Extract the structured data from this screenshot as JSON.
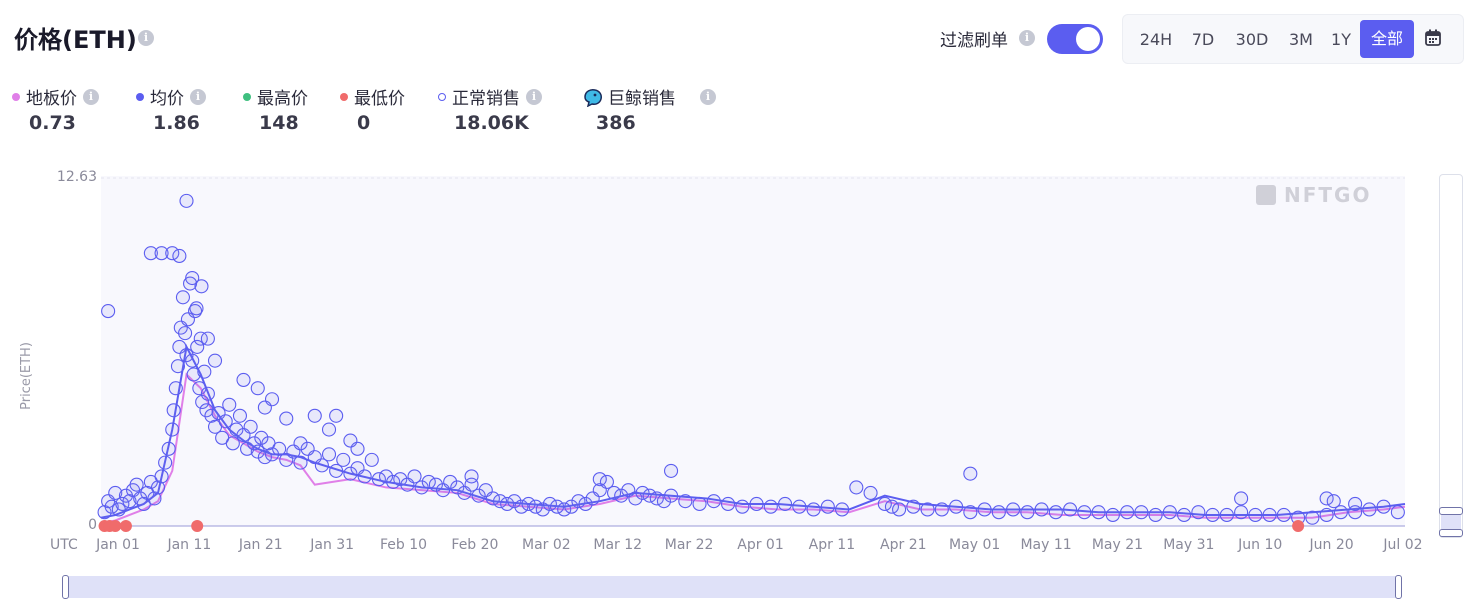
{
  "header": {
    "title": "价格(ETH)",
    "filter_label": "过滤刷单",
    "filter_on": true,
    "ranges": [
      "24H",
      "7D",
      "30D",
      "3M",
      "1Y",
      "全部"
    ],
    "active_range": "全部"
  },
  "legend": [
    {
      "label": "地板价",
      "value": "0.73",
      "color": "#e07fe8",
      "marker": "dot"
    },
    {
      "label": "均价",
      "value": "1.86",
      "color": "#5b5df0",
      "marker": "dot"
    },
    {
      "label": "最高价",
      "value": "148",
      "color": "#3fbf7f",
      "marker": "dot"
    },
    {
      "label": "最低价",
      "value": "0",
      "color": "#f06b6b",
      "marker": "dot"
    },
    {
      "label": "正常销售",
      "value": "18.06K",
      "color": "#5b5df0",
      "marker": "ring"
    },
    {
      "label": "巨鲸销售",
      "value": "386",
      "color": "#2a9fd6",
      "marker": "whale"
    }
  ],
  "chart_data": {
    "type": "scatter",
    "ylabel": "Price(ETH)",
    "ylim": [
      0,
      12.63
    ],
    "yticks": [
      "0",
      "12.63"
    ],
    "xlabel_prefix": "UTC",
    "xticks": [
      "Jan 01",
      "Jan 11",
      "Jan 21",
      "Jan 31",
      "Feb 10",
      "Feb 20",
      "Mar 02",
      "Mar 12",
      "Mar 22",
      "Apr 01",
      "Apr 11",
      "Apr 21",
      "May 01",
      "May 11",
      "May 21",
      "May 31",
      "Jun 10",
      "Jun 20",
      "Jul 02"
    ],
    "xlim_days": [
      0,
      183
    ],
    "watermark": "NFTGO",
    "series": [
      {
        "name": "地板价",
        "color": "#e07fe8",
        "x": [
          0,
          2,
          4,
          6,
          8,
          10,
          12,
          14,
          16,
          18,
          20,
          22,
          24,
          26,
          28,
          30,
          35,
          40,
          45,
          50,
          55,
          60,
          65,
          70,
          75,
          80,
          85,
          90,
          95,
          100,
          105,
          110,
          115,
          120,
          125,
          130,
          135,
          140,
          145,
          150,
          155,
          160,
          165,
          170,
          175,
          180,
          183
        ],
        "y": [
          0.1,
          0.2,
          0.4,
          0.6,
          0.9,
          2.0,
          5.5,
          5.0,
          4.0,
          3.3,
          3.0,
          2.7,
          2.5,
          2.4,
          2.2,
          1.5,
          1.7,
          1.4,
          1.3,
          1.2,
          0.8,
          0.7,
          0.6,
          0.8,
          1.1,
          1.0,
          0.9,
          0.7,
          0.6,
          0.6,
          0.5,
          0.9,
          0.6,
          0.6,
          0.5,
          0.5,
          0.4,
          0.4,
          0.4,
          0.4,
          0.3,
          0.3,
          0.3,
          0.3,
          0.5,
          0.6,
          0.7
        ]
      },
      {
        "name": "均价",
        "color": "#5b5df0",
        "x": [
          0,
          2,
          4,
          6,
          8,
          10,
          12,
          14,
          16,
          18,
          20,
          22,
          24,
          26,
          28,
          30,
          35,
          40,
          45,
          50,
          55,
          60,
          65,
          70,
          75,
          80,
          85,
          90,
          95,
          100,
          105,
          110,
          115,
          120,
          125,
          130,
          135,
          140,
          145,
          150,
          155,
          160,
          165,
          170,
          175,
          180,
          183
        ],
        "y": [
          0.3,
          0.4,
          0.6,
          0.8,
          1.2,
          3.5,
          6.5,
          5.5,
          4.2,
          3.5,
          3.1,
          2.8,
          2.6,
          2.6,
          2.5,
          2.3,
          1.9,
          1.6,
          1.4,
          1.3,
          0.9,
          0.8,
          0.7,
          0.9,
          1.2,
          1.1,
          1.0,
          0.8,
          0.8,
          0.7,
          0.6,
          1.1,
          0.8,
          0.7,
          0.6,
          0.6,
          0.6,
          0.5,
          0.5,
          0.5,
          0.4,
          0.4,
          0.4,
          0.5,
          0.6,
          0.7,
          0.8
        ]
      },
      {
        "name": "正常销售",
        "color": "#5b5df0",
        "x": [
          0.5,
          1,
          1.5,
          2,
          2.5,
          3,
          3.5,
          4,
          4.5,
          5,
          5.5,
          6,
          6.5,
          7,
          7.5,
          8,
          8.5,
          9,
          9.5,
          10,
          10.2,
          10.5,
          10.8,
          11,
          11.2,
          11.5,
          11.8,
          12,
          12.2,
          12.5,
          12.8,
          13,
          13.2,
          13.5,
          13.8,
          14,
          14.2,
          14.5,
          14.8,
          15,
          15.5,
          16,
          16.5,
          17,
          17.5,
          18,
          18.5,
          19,
          19.5,
          20,
          20.5,
          21,
          21.5,
          22,
          22.5,
          23,
          23.5,
          24,
          25,
          26,
          27,
          28,
          29,
          30,
          31,
          32,
          33,
          34,
          35,
          36,
          37,
          38,
          39,
          40,
          41,
          42,
          43,
          44,
          45,
          46,
          47,
          48,
          49,
          50,
          51,
          52,
          53,
          54,
          55,
          56,
          57,
          58,
          59,
          60,
          61,
          62,
          63,
          64,
          65,
          66,
          67,
          68,
          69,
          70,
          71,
          72,
          73,
          74,
          75,
          76,
          77,
          78,
          79,
          80,
          82,
          84,
          86,
          88,
          90,
          92,
          94,
          96,
          98,
          100,
          102,
          104,
          106,
          108,
          110,
          111,
          112,
          114,
          116,
          118,
          120,
          122,
          124,
          126,
          128,
          130,
          132,
          134,
          136,
          138,
          140,
          142,
          144,
          146,
          148,
          150,
          152,
          154,
          156,
          158,
          160,
          162,
          164,
          166,
          168,
          170,
          172,
          174,
          176,
          178,
          180,
          182,
          1,
          7,
          8.5,
          10,
          11,
          12,
          12.8,
          13.4,
          14.1,
          15,
          16,
          20,
          22,
          23,
          24,
          26,
          28,
          30,
          32,
          33,
          35,
          36,
          52,
          70,
          80,
          122,
          160,
          172,
          173,
          176
        ],
        "y": [
          0.5,
          0.9,
          0.7,
          1.2,
          0.6,
          0.8,
          1.1,
          0.9,
          1.3,
          1.5,
          1.0,
          0.8,
          1.2,
          1.6,
          1.0,
          1.4,
          1.8,
          2.3,
          2.8,
          3.5,
          4.2,
          5.0,
          5.8,
          6.5,
          7.2,
          8.3,
          7.0,
          6.2,
          7.5,
          8.8,
          6.0,
          5.5,
          7.8,
          6.5,
          5.0,
          6.8,
          4.5,
          5.6,
          4.2,
          4.8,
          4.0,
          3.6,
          4.1,
          3.2,
          3.8,
          4.4,
          3.0,
          3.5,
          4.0,
          3.3,
          2.8,
          3.6,
          3.0,
          2.7,
          3.2,
          2.5,
          3.0,
          2.6,
          2.8,
          2.4,
          2.7,
          2.3,
          2.8,
          2.5,
          2.2,
          2.6,
          2.0,
          2.4,
          1.9,
          2.1,
          1.8,
          2.4,
          1.7,
          1.8,
          1.6,
          1.7,
          1.5,
          1.8,
          1.4,
          1.6,
          1.5,
          1.3,
          1.6,
          1.4,
          1.2,
          1.5,
          1.1,
          1.3,
          1.0,
          0.9,
          0.8,
          0.9,
          0.7,
          0.8,
          0.7,
          0.6,
          0.8,
          0.7,
          0.6,
          0.7,
          0.9,
          0.8,
          1.0,
          1.3,
          1.6,
          1.2,
          1.1,
          1.3,
          1.0,
          1.2,
          1.1,
          1.0,
          0.9,
          1.1,
          0.9,
          0.8,
          0.9,
          0.8,
          0.7,
          0.8,
          0.7,
          0.8,
          0.7,
          0.6,
          0.7,
          0.6,
          1.4,
          1.2,
          0.8,
          0.7,
          0.6,
          0.7,
          0.6,
          0.6,
          0.7,
          0.5,
          0.6,
          0.5,
          0.6,
          0.5,
          0.6,
          0.5,
          0.6,
          0.5,
          0.5,
          0.4,
          0.5,
          0.5,
          0.4,
          0.5,
          0.4,
          0.5,
          0.4,
          0.4,
          0.5,
          0.4,
          0.4,
          0.4,
          0.3,
          0.3,
          0.4,
          0.5,
          0.5,
          0.6,
          0.7,
          0.5,
          7.8,
          9.9,
          9.9,
          9.9,
          9.8,
          11.8,
          9.0,
          7.9,
          8.7,
          6.8,
          6.0,
          5.3,
          5.0,
          4.3,
          4.6,
          3.9,
          3.0,
          4.0,
          3.5,
          4.0,
          3.1,
          2.8,
          1.8,
          1.7,
          2.0,
          1.9,
          1.0,
          1.0,
          0.9,
          0.8
        ]
      },
      {
        "name": "最低价",
        "color": "#f06b6b",
        "x": [
          0.5,
          1.2,
          2.0,
          3.5,
          13.5,
          168
        ],
        "y": [
          0,
          0,
          0,
          0,
          0,
          0
        ]
      }
    ]
  }
}
